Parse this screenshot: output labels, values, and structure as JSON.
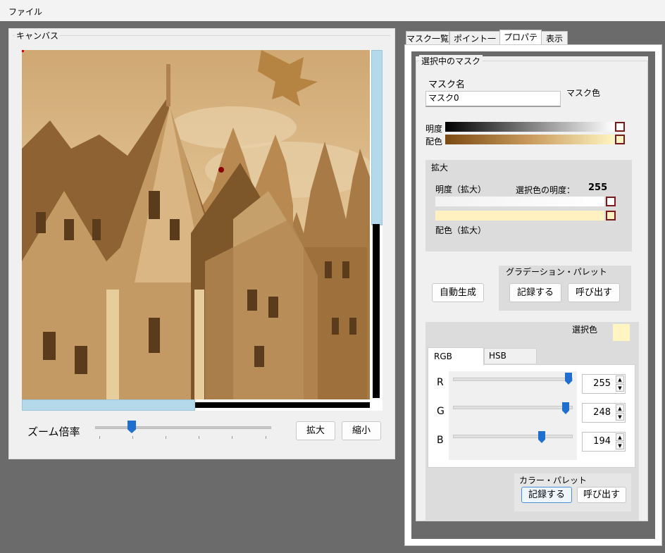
{
  "menu": {
    "file": "ファイル"
  },
  "canvas": {
    "legend": "キャンバス",
    "zoom_label": "ズーム倍率",
    "zoom_in": "拡大",
    "zoom_out": "縮小",
    "zoom_level_fraction": 0.2
  },
  "tabs": [
    "マスク一覧",
    "ポイント一覧",
    "プロパティ",
    "表示"
  ],
  "active_tab": "プロパティ",
  "mask": {
    "group_title": "選択中のマスク",
    "name_label": "マスク名",
    "name_value": "マスク0",
    "color_label": "マスク色",
    "brightness_label": "明度",
    "coloring_label": "配色"
  },
  "zoom_section": {
    "title": "拡大",
    "brightness_label": "明度（拡大）",
    "selected_brightness_label": "選択色の明度：",
    "selected_brightness_value": "255",
    "coloring_label": "配色（拡大）"
  },
  "auto_generate": "自動生成",
  "gradient_palette": {
    "title": "グラデーション・パレット",
    "save": "記録する",
    "load": "呼び出す"
  },
  "color_picker": {
    "selected_color_label": "選択色",
    "selected_color": "#fff5c2",
    "tabs": [
      "RGB",
      "HSB"
    ],
    "active_tab": "RGB",
    "channels": [
      {
        "label": "R",
        "value": "255"
      },
      {
        "label": "G",
        "value": "248"
      },
      {
        "label": "B",
        "value": "194"
      }
    ]
  },
  "color_palette": {
    "title": "カラー・パレット",
    "save": "記録する",
    "load": "呼び出す"
  },
  "colors": {
    "accent": "#1f6fce",
    "scroll_thumb": "#b3d9ea",
    "swatch_border": "#7a1a1a",
    "sepia": "#c9a063"
  },
  "icons": {
    "spin_up": "▲",
    "spin_down": "▼"
  }
}
